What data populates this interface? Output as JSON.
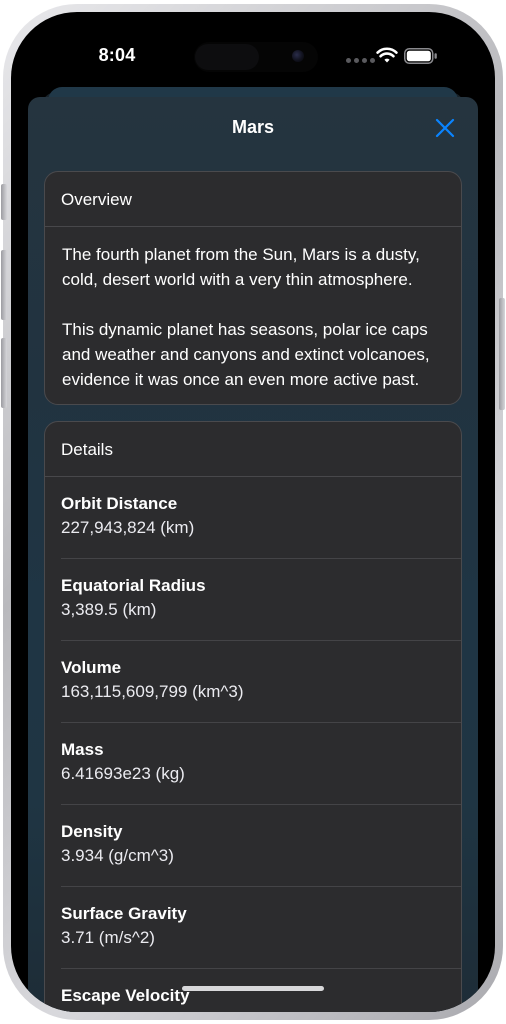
{
  "status_bar": {
    "time": "8:04"
  },
  "sheet": {
    "title": "Mars",
    "close_icon": "xmark-icon",
    "accent_color": "#0a84ff"
  },
  "overview": {
    "header": "Overview",
    "paragraphs": [
      "The fourth planet from the Sun, Mars is a dusty, cold, desert world with a very thin atmosphere.",
      "This dynamic planet has seasons, polar ice caps and weather and canyons and extinct volcanoes, evidence it was once an even more active past."
    ]
  },
  "details": {
    "header": "Details",
    "rows": [
      {
        "label": "Orbit Distance",
        "value": "227,943,824 (km)"
      },
      {
        "label": "Equatorial Radius",
        "value": "3,389.5 (km)"
      },
      {
        "label": "Volume",
        "value": "163,115,609,799 (km^3)"
      },
      {
        "label": "Mass",
        "value": "6.41693e23 (kg)"
      },
      {
        "label": "Density",
        "value": "3.934 (g/cm^3)"
      },
      {
        "label": "Surface Gravity",
        "value": "3.71 (m/s^2)"
      },
      {
        "label": "Escape Velocity",
        "value": ""
      }
    ]
  }
}
